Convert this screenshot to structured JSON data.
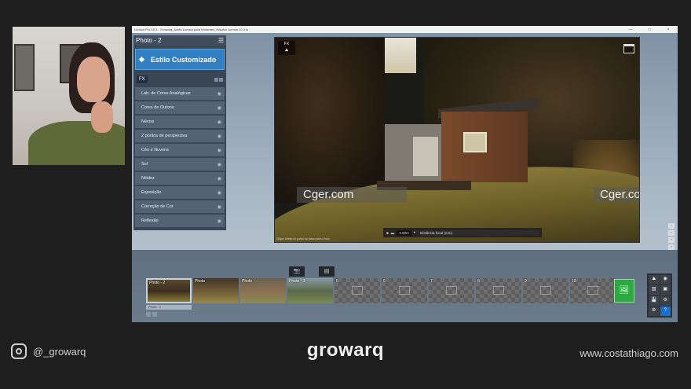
{
  "window": {
    "title": "Lumion Pro 10.3 - Growarq_Aulão Lumion para Iniciantes_Arquivo Lumion 10.3.ls",
    "controls": [
      "—",
      "□",
      "×"
    ]
  },
  "left_panel": {
    "header": "Photo - 2",
    "style_button": "Estilo Customizado",
    "fx_tab": "FX",
    "effects": [
      "Lab. de Cores Analógicas",
      "Cores de Outono",
      "Névoa",
      "2 pontos de perspectiva",
      "Céu e Nuvens",
      "Sol",
      "Nitidez",
      "Exposição",
      "Correção de Cor",
      "Reflexão"
    ]
  },
  "viewport": {
    "fx_label": "FX",
    "watermark_left": "Cger.com",
    "watermark_right": "Cger.com",
    "focus_distance": "3.00m",
    "focal_label": "Distância focal (mm)",
    "hint": "Clique direito no ponto do plano para o foco"
  },
  "timeline": {
    "thumbs": [
      {
        "label": "Photo - 2",
        "type": "photo1"
      },
      {
        "label": "Photo",
        "type": "photo2"
      },
      {
        "label": "Photo",
        "type": "photo3"
      },
      {
        "label": "Photo - 3",
        "type": "photo4"
      },
      {
        "label": "5",
        "type": "empty"
      },
      {
        "label": "6",
        "type": "empty"
      },
      {
        "label": "7",
        "type": "empty"
      },
      {
        "label": "8",
        "type": "empty"
      },
      {
        "label": "9",
        "type": "empty"
      },
      {
        "label": "10",
        "type": "empty"
      }
    ],
    "under_label": "Photo - 2",
    "help": "?"
  },
  "footer": {
    "instagram": "@_growarq",
    "logo": "growarq",
    "website": "www.costathiago.com"
  },
  "colors": {
    "accent_blue": "#2f7fc2",
    "add_green": "#2fa843",
    "background": "#1e1e1e"
  }
}
